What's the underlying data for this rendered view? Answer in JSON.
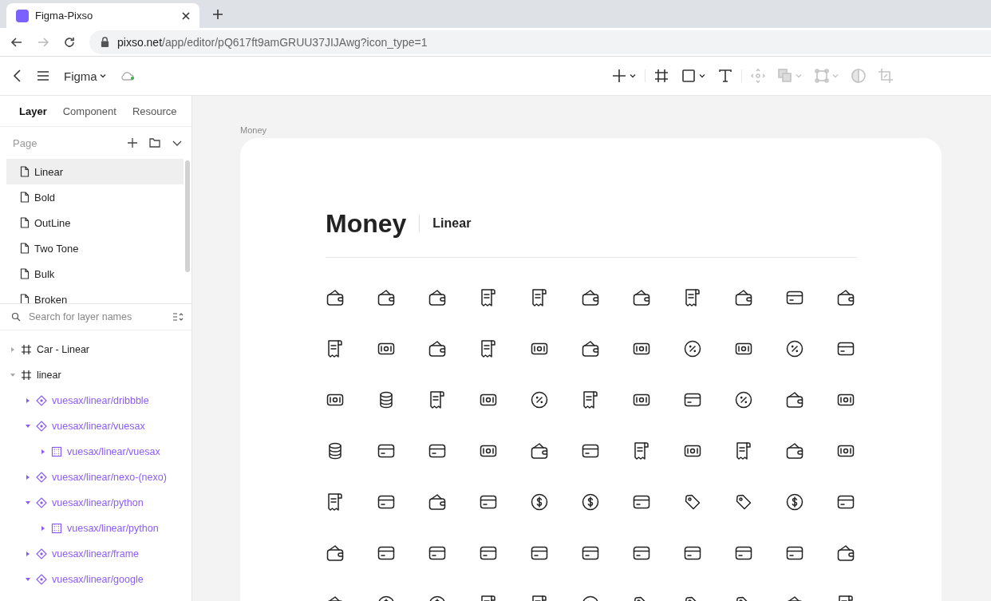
{
  "browser": {
    "tab": {
      "title": "Figma-Pixso"
    },
    "url": {
      "host": "pixso.net",
      "path": "/app/editor/pQ617ft9amGRUU37JIJAwg?icon_type=1"
    },
    "forward_disabled": true
  },
  "toolbar": {
    "file_name": "Figma",
    "tools": [
      {
        "kind": "add",
        "dropdown": true,
        "disabled": false
      },
      {
        "kind": "frame",
        "dropdown": false,
        "disabled": false
      },
      {
        "kind": "shape",
        "dropdown": true,
        "disabled": false
      },
      {
        "kind": "text",
        "dropdown": false,
        "disabled": false
      },
      {
        "kind": "move",
        "dropdown": false,
        "disabled": true
      },
      {
        "kind": "boolean",
        "dropdown": true,
        "disabled": true
      },
      {
        "kind": "vector",
        "dropdown": true,
        "disabled": true
      },
      {
        "kind": "mask",
        "dropdown": false,
        "disabled": true
      },
      {
        "kind": "crop",
        "dropdown": false,
        "disabled": true
      }
    ]
  },
  "sidebar": {
    "tabs": [
      {
        "label": "Layer",
        "selected": true
      },
      {
        "label": "Component",
        "selected": false
      },
      {
        "label": "Resource",
        "selected": false
      }
    ],
    "page_header": "Page",
    "pages": [
      {
        "name": "Linear",
        "selected": true
      },
      {
        "name": "Bold",
        "selected": false
      },
      {
        "name": "OutLine",
        "selected": false
      },
      {
        "name": "Two Tone",
        "selected": false
      },
      {
        "name": "Bulk",
        "selected": false
      },
      {
        "name": "Broken",
        "selected": false
      }
    ],
    "search": {
      "placeholder": "Search for layer names"
    },
    "layers": [
      {
        "name": "Car - Linear",
        "kind": "frame",
        "expanded": false
      },
      {
        "name": "linear",
        "kind": "frame",
        "expanded": true,
        "children": [
          {
            "name": "vuesax/linear/dribbble",
            "kind": "component",
            "expanded": false
          },
          {
            "name": "vuesax/linear/vuesax",
            "kind": "component",
            "expanded": true,
            "children": [
              {
                "name": "vuesax/linear/vuesax",
                "kind": "group",
                "expanded": false
              }
            ]
          },
          {
            "name": "vuesax/linear/nexo-(nexo)",
            "kind": "component",
            "expanded": false
          },
          {
            "name": "vuesax/linear/python",
            "kind": "component",
            "expanded": true,
            "children": [
              {
                "name": "vuesax/linear/python",
                "kind": "group",
                "expanded": false
              }
            ]
          },
          {
            "name": "vuesax/linear/frame",
            "kind": "component",
            "expanded": false
          },
          {
            "name": "vuesax/linear/google",
            "kind": "component",
            "expanded": true
          }
        ]
      }
    ]
  },
  "canvas": {
    "frame_label": "Money",
    "title": "Money",
    "subtitle": "Linear"
  }
}
